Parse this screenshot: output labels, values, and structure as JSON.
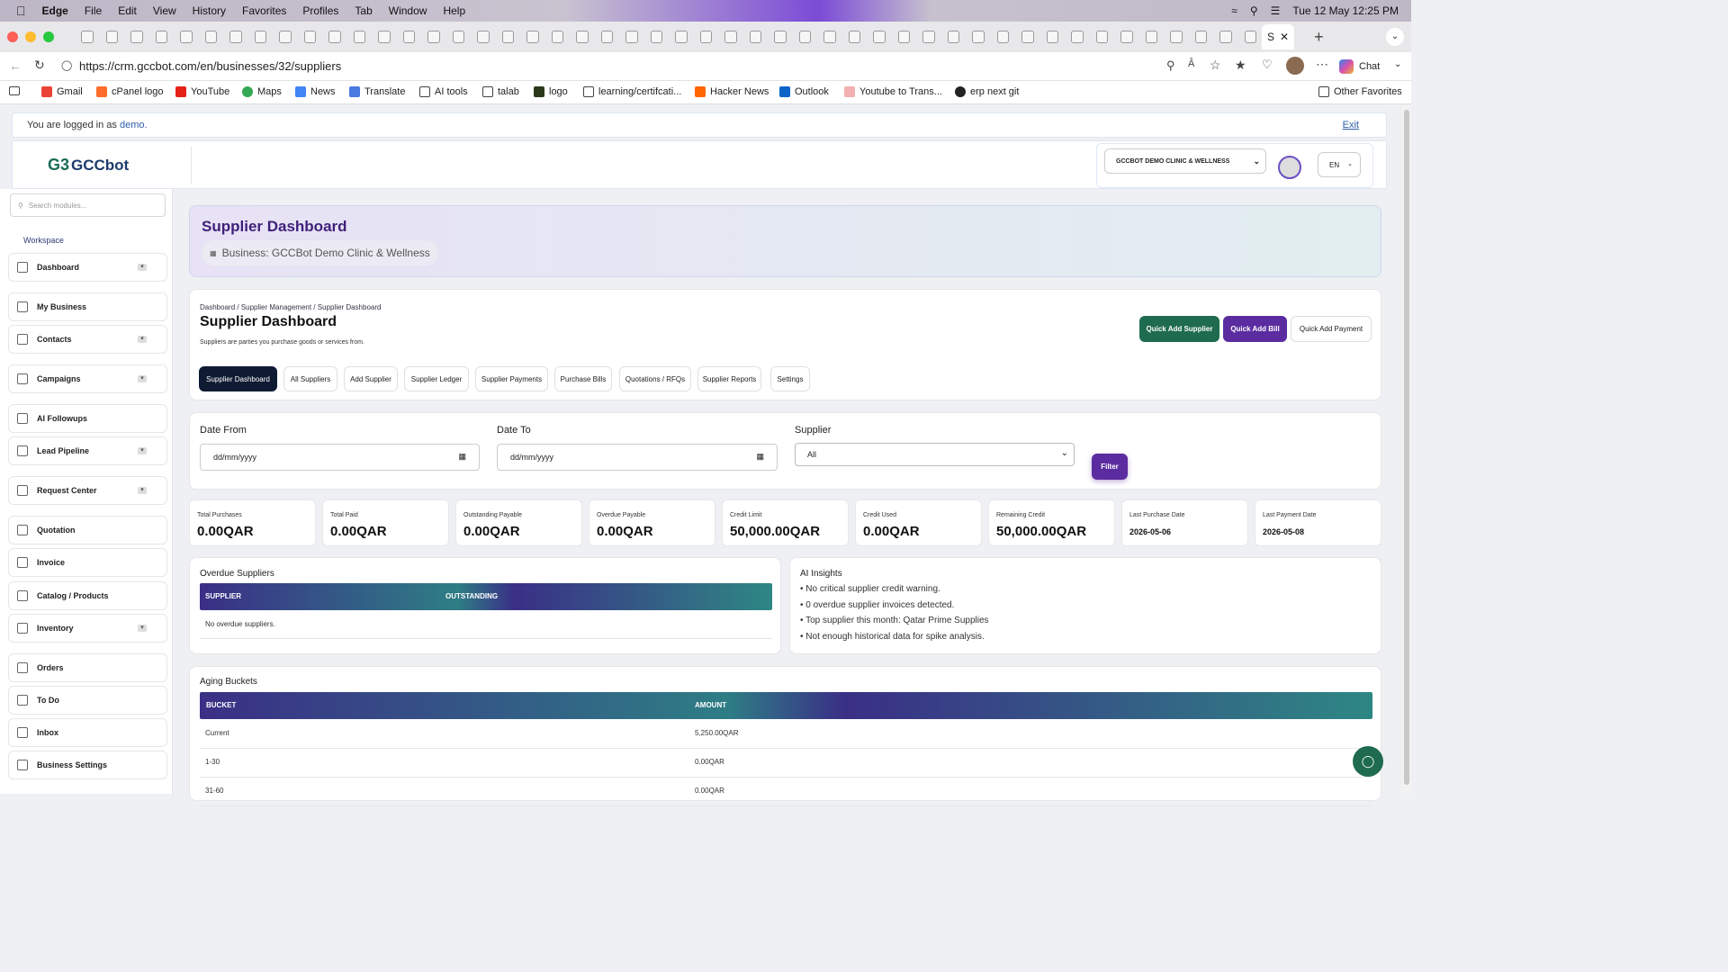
{
  "menubar": {
    "app": "Edge",
    "items": [
      "File",
      "Edit",
      "View",
      "History",
      "Favorites",
      "Profiles",
      "Tab",
      "Window",
      "Help"
    ],
    "datetime": "Tue 12 May  12:25 PM"
  },
  "browser": {
    "url": "https://crm.gccbot.com/en/businesses/32/suppliers",
    "active_tab": "S",
    "chat_label": "Chat",
    "bookmarks": [
      "Gmail",
      "cPanel logo",
      "YouTube",
      "Maps",
      "News",
      "Translate",
      "AI tools",
      "talab",
      "logo",
      "learning/certifcati...",
      "Hacker News",
      "Outlook",
      "Youtube to Trans...",
      "erp next git"
    ],
    "other_favorites": "Other Favorites"
  },
  "login": {
    "text": "You are logged in as",
    "user": "demo.",
    "exit": "Exit"
  },
  "header": {
    "logo": "GCCbot",
    "business_select": "GCCBOT DEMO CLINIC & WELLNESS",
    "lang": "EN"
  },
  "sidebar": {
    "search_placeholder": "Search modules...",
    "section": "Workspace",
    "items": [
      "Dashboard",
      "My Business",
      "Contacts",
      "Campaigns",
      "AI Followups",
      "Lead Pipeline",
      "Request Center",
      "Quotation",
      "Invoice",
      "Catalog / Products",
      "Inventory",
      "Orders",
      "To Do",
      "Inbox",
      "Business Settings"
    ]
  },
  "banner": {
    "title": "Supplier Dashboard",
    "business": "Business: GCCBot Demo Clinic & Wellness"
  },
  "main": {
    "breadcrumb": "Dashboard / Supplier Management / Supplier Dashboard",
    "title": "Supplier Dashboard",
    "subtitle": "Suppliers are parties you purchase goods or services from.",
    "buttons": {
      "quick_add_supplier": "Quick Add Supplier",
      "quick_add_bill": "Quick Add Bill",
      "quick_add_payment": "Quick Add Payment"
    },
    "tabs": [
      "Supplier Dashboard",
      "All Suppliers",
      "Add Supplier",
      "Supplier Ledger",
      "Supplier Payments",
      "Purchase Bills",
      "Quotations / RFQs",
      "Supplier Reports",
      "Settings"
    ]
  },
  "filter": {
    "date_from_label": "Date From",
    "date_from": "dd/mm/yyyy",
    "date_to_label": "Date To",
    "date_to": "dd/mm/yyyy",
    "supplier_label": "Supplier",
    "supplier_value": "All",
    "button": "Filter"
  },
  "stats": [
    {
      "label": "Total Purchases",
      "value": "0.00QAR"
    },
    {
      "label": "Total Paid",
      "value": "0.00QAR"
    },
    {
      "label": "Outstanding Payable",
      "value": "0.00QAR"
    },
    {
      "label": "Overdue Payable",
      "value": "0.00QAR"
    },
    {
      "label": "Credit Limit",
      "value": "50,000.00QAR"
    },
    {
      "label": "Credit Used",
      "value": "0.00QAR"
    },
    {
      "label": "Remaining Credit",
      "value": "50,000.00QAR"
    },
    {
      "label": "Last Purchase Date",
      "value": "2026-05-06"
    },
    {
      "label": "Last Payment Date",
      "value": "2026-05-08"
    }
  ],
  "overdue": {
    "title": "Overdue Suppliers",
    "col1": "SUPPLIER",
    "col2": "OUTSTANDING",
    "empty": "No overdue suppliers."
  },
  "insights": {
    "title": "AI Insights",
    "items": [
      "No critical supplier credit warning.",
      "0 overdue supplier invoices detected.",
      "Top supplier this month: Qatar Prime Supplies",
      "Not enough historical data for spike analysis."
    ]
  },
  "aging": {
    "title": "Aging Buckets",
    "col1": "BUCKET",
    "col2": "AMOUNT",
    "rows": [
      {
        "bucket": "Current",
        "amount": "5,250.00QAR"
      },
      {
        "bucket": "1-30",
        "amount": "0.00QAR"
      },
      {
        "bucket": "31-60",
        "amount": "0.00QAR"
      }
    ]
  },
  "colors": {
    "purple": "#5b2ca0",
    "green": "#1f6b4f",
    "navy": "#0f1b33"
  }
}
